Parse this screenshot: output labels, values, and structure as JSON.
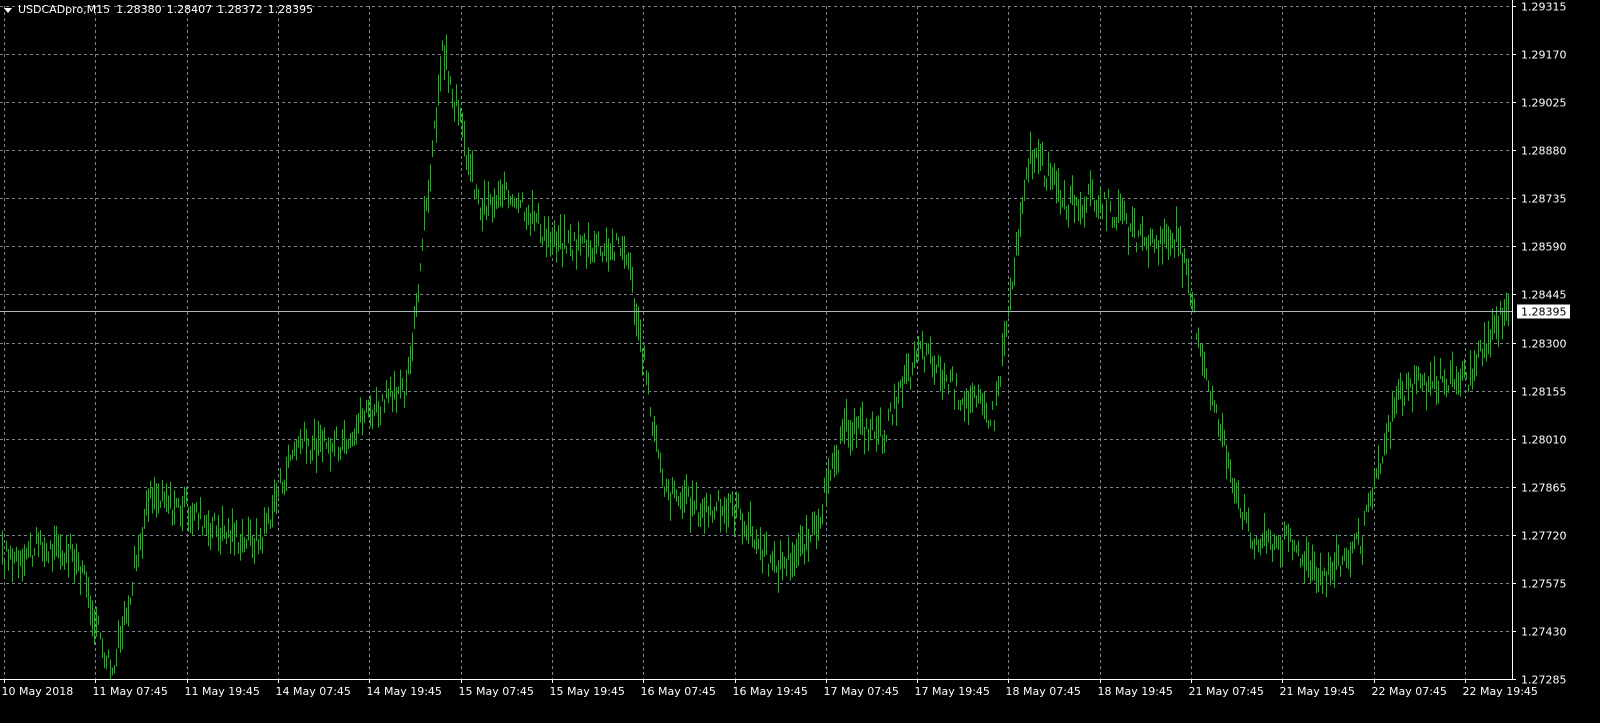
{
  "colors": {
    "background": "#000000",
    "grid": "#7a8590",
    "candle": "#00c800",
    "current_price_line": "#aab4be",
    "axis_text": "#ffffff",
    "price_box_bg": "#ffffff",
    "price_box_text": "#000000"
  },
  "header": {
    "symbol": "USDCADpro,M15",
    "ohlc": [
      "1.28380",
      "1.28407",
      "1.28372",
      "1.28395"
    ]
  },
  "chart_data": {
    "type": "line",
    "title": "",
    "xlabel": "",
    "ylabel": "",
    "ylim": [
      1.27285,
      1.29315
    ],
    "yticks": [
      "1.29315",
      "1.29170",
      "1.29025",
      "1.28880",
      "1.28735",
      "1.28590",
      "1.28445",
      "1.28300",
      "1.28155",
      "1.28010",
      "1.27865",
      "1.27720",
      "1.27575",
      "1.27430",
      "1.27285"
    ],
    "xticks": [
      "10 May 2018",
      "11 May 07:45",
      "11 May 19:45",
      "14 May 07:45",
      "14 May 19:45",
      "15 May 07:45",
      "15 May 19:45",
      "16 May 07:45",
      "16 May 19:45",
      "17 May 07:45",
      "17 May 19:45",
      "18 May 07:45",
      "18 May 19:45",
      "21 May 07:45",
      "21 May 19:45",
      "22 May 07:45",
      "22 May 19:45"
    ],
    "current_price": "1.28395",
    "grid": true,
    "series": [
      {
        "x": [
          "10 May 2018",
          "11 May 01:45",
          "11 May 07:45",
          "11 May 10:45",
          "11 May 19:45",
          "11 May 22:45",
          "14 May 07:45",
          "14 May 10:45",
          "14 May 19:45",
          "14 May 22:45",
          "15 May 04:45",
          "15 May 07:45",
          "15 May 10:45",
          "15 May 13:45",
          "15 May 19:45",
          "15 May 22:45",
          "16 May 04:45",
          "16 May 07:45",
          "16 May 10:45",
          "16 May 16:45",
          "16 May 19:45",
          "16 May 22:45",
          "17 May 07:45",
          "17 May 10:45",
          "17 May 19:45",
          "17 May 22:45",
          "18 May 04:45",
          "18 May 07:45",
          "18 May 10:45",
          "18 May 16:45",
          "18 May 19:45",
          "21 May 01:45",
          "21 May 07:45",
          "21 May 10:45",
          "21 May 16:45",
          "21 May 19:45",
          "22 May 01:45",
          "22 May 07:45",
          "22 May 10:45",
          "22 May 16:45",
          "22 May 19:45",
          "22 May 22:45"
        ],
        "y": [
          1.2765,
          1.2768,
          1.2766,
          1.273,
          1.2783,
          1.278,
          1.2773,
          1.277,
          1.28,
          1.2798,
          1.281,
          1.2815,
          1.2918,
          1.287,
          1.2875,
          1.286,
          1.286,
          1.2858,
          1.2785,
          1.278,
          1.278,
          1.2762,
          1.277,
          1.2805,
          1.2803,
          1.2828,
          1.2815,
          1.2808,
          1.2888,
          1.2872,
          1.2873,
          1.286,
          1.2862,
          1.281,
          1.277,
          1.277,
          1.276,
          1.277,
          1.2815,
          1.2818,
          1.282,
          1.2843
        ]
      }
    ]
  }
}
